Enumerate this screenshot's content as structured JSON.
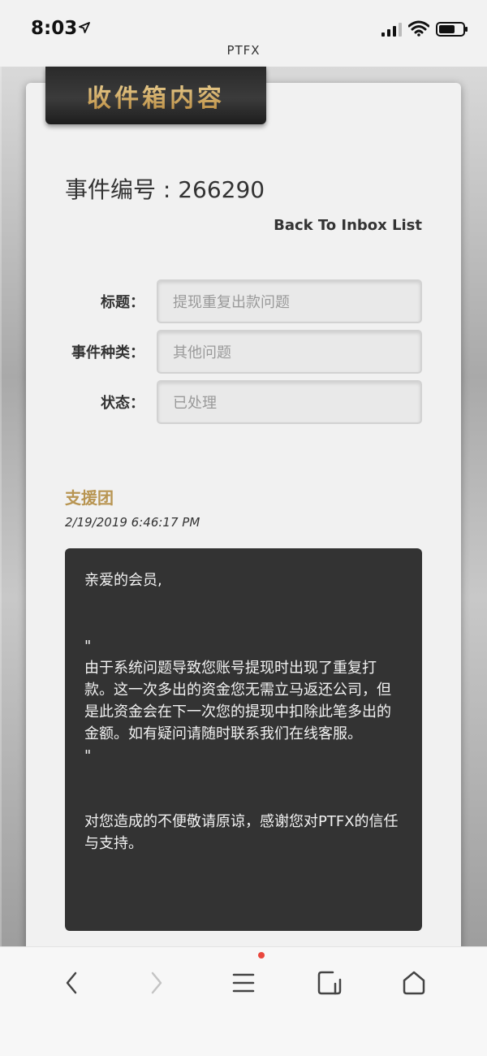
{
  "status_bar": {
    "time": "8:03",
    "site_title": "PTFX"
  },
  "banner": {
    "title": "收件箱内容"
  },
  "ticket": {
    "title": "事件编号 : 266290"
  },
  "back_link": "Back To Inbox List",
  "form": [
    {
      "label": "标题：",
      "value": "提现重复出款问题"
    },
    {
      "label": "事件种类：",
      "value": "其他问题"
    },
    {
      "label": "状态：",
      "value": "已处理"
    }
  ],
  "reply": {
    "author": "支援团",
    "timestamp": "2/19/2019 6:46:17 PM",
    "greeting": "亲爱的会员,",
    "quote_open": "\"",
    "body": "由于系统问题导致您账号提现时出现了重复打款。这一次多出的资金您无需立马返还公司，但是此资金会在下一次您的提现中扣除此笔多出的金额。如有疑问请随时联系我们在线客服。",
    "quote_close": "\"",
    "closing": "对您造成的不便敬请原谅，感谢您对PTFX的信任与支持。"
  },
  "bottom_nav": {
    "items": [
      {
        "icon": "back-icon"
      },
      {
        "icon": "forward-icon"
      },
      {
        "icon": "menu-icon"
      },
      {
        "icon": "tabs-icon"
      },
      {
        "icon": "home-icon"
      }
    ]
  },
  "colors": {
    "gold": "#b89552",
    "dark": "#333333",
    "badge": "#e9473d"
  }
}
